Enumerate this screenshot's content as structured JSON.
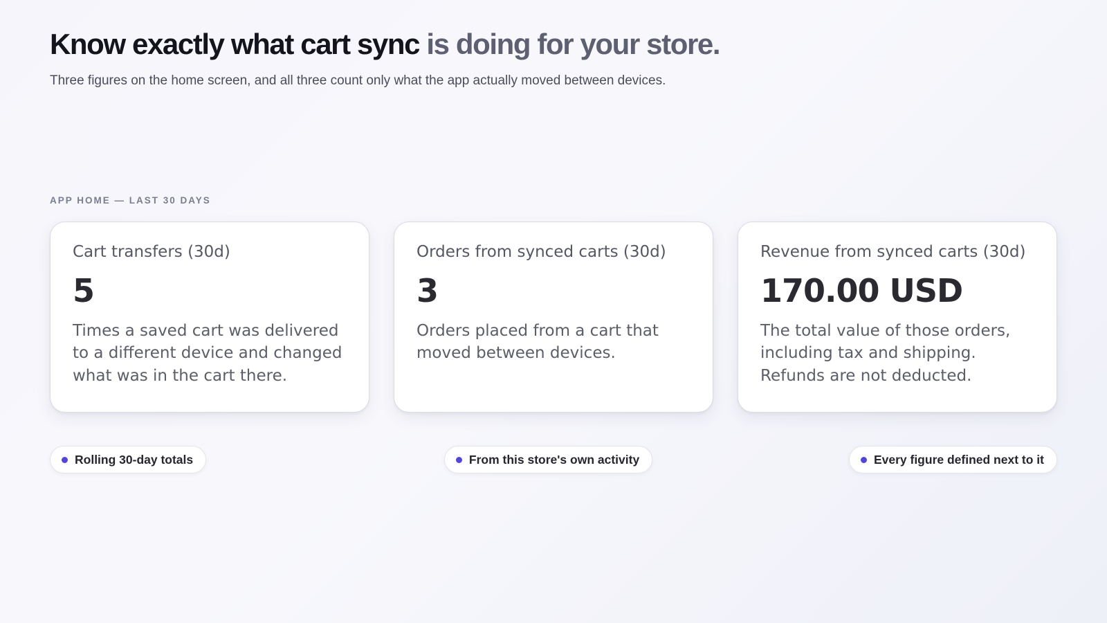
{
  "hero": {
    "title_strong": "Know exactly what cart sync",
    "title_muted": " is doing for your store.",
    "subtitle": "Three figures on the home screen, and all three count only what the app actually moved between devices."
  },
  "section": {
    "label": "APP HOME — LAST 30 DAYS"
  },
  "cards": [
    {
      "label": "Cart transfers (30d)",
      "value": "5",
      "description": "Times a saved cart was delivered to a different device and changed what was in the cart there."
    },
    {
      "label": "Orders from synced carts (30d)",
      "value": "3",
      "description": "Orders placed from a cart that moved between devices."
    },
    {
      "label": "Revenue from synced carts (30d)",
      "value": "170.00 USD",
      "description": "The total value of those orders, including tax and shipping. Refunds are not deducted."
    }
  ],
  "pills": [
    {
      "label": "Rolling 30-day totals"
    },
    {
      "label": "From this store's own activity"
    },
    {
      "label": "Every figure defined next to it"
    }
  ],
  "colors": {
    "accent_dot": "#5146d8",
    "title_dark": "#14141c",
    "title_muted": "#5e6072"
  }
}
